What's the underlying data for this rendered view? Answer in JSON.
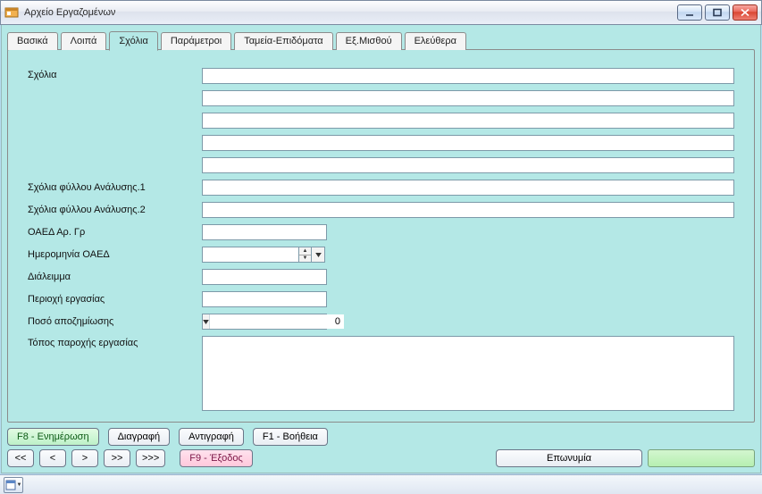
{
  "window": {
    "title": "Αρχείο Εργαζομένων"
  },
  "tabs": [
    {
      "label": "Βασικά",
      "active": false
    },
    {
      "label": "Λοιπά",
      "active": false
    },
    {
      "label": "Σχόλια",
      "active": true
    },
    {
      "label": "Παράμετροι",
      "active": false
    },
    {
      "label": "Ταμεία-Επιδόματα",
      "active": false
    },
    {
      "label": "Εξ.Μισθού",
      "active": false
    },
    {
      "label": "Ελεύθερα",
      "active": false
    }
  ],
  "form": {
    "labels": {
      "sxolia": "Σχόλια",
      "sxoliafa1": "Σχόλια φύλλου Ανάλυσης.1",
      "sxoliafa2": "Σχόλια φύλλου Ανάλυσης.2",
      "oaedargr": "ΟΑΕΔ Αρ. Γρ",
      "hmoaed": "Ημερομηνία ΟΑΕΔ",
      "dialeimma": "Διάλειμμα",
      "perioxi": "Περιοχή εργασίας",
      "poso": "Ποσό αποζημίωσης",
      "topos": "Τόπος παροχής εργασίας"
    },
    "values": {
      "sxolia": [
        "",
        "",
        "",
        "",
        ""
      ],
      "sxoliafa1": "",
      "sxoliafa2": "",
      "oaedargr": "",
      "hmoaed": "",
      "dialeimma": "",
      "perioxi": "",
      "poso": "0",
      "topos": ""
    }
  },
  "actions": {
    "row1": {
      "f8": "F8 - Ενημέρωση",
      "del": "Διαγραφή",
      "copy": "Αντιγραφή",
      "f1": "F1 - Βοήθεια"
    },
    "row2": {
      "first": "<<",
      "prev": "<",
      "next": ">",
      "last": ">>",
      "lastp": ">>>",
      "f9": "F9 - Έξοδος",
      "eponymia": "Επωνυμία"
    }
  }
}
